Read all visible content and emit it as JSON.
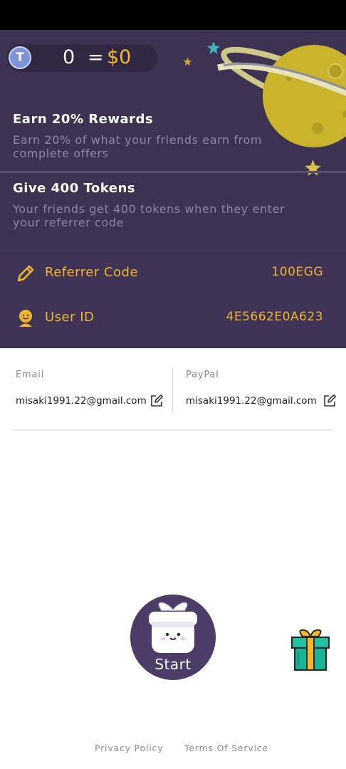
{
  "balance": {
    "tokens": "0",
    "equals": "=",
    "usd": "$0",
    "coin_letter": "T"
  },
  "rewards": [
    {
      "title": "Earn 20% Rewards",
      "desc": "Earn 20% of what your friends earn from complete offers"
    },
    {
      "title": "Give 400 Tokens",
      "desc": "Your friends get 400 tokens when they enter your referrer code"
    }
  ],
  "info": {
    "referrer": {
      "label": "Referrer Code",
      "value": "100EGG"
    },
    "user": {
      "label": "User ID",
      "value": "4E5662E0A623"
    }
  },
  "payment": {
    "email": {
      "label": "Email",
      "value": "misaki1991.22@gmail.com"
    },
    "paypal": {
      "label": "PayPal",
      "value": "misaki1991.22@gmail.com"
    }
  },
  "start": {
    "label": "Start"
  },
  "footer": {
    "privacy": "Privacy Policy",
    "terms": "Terms Of Service"
  },
  "colors": {
    "hero_bg": "#3d3252",
    "accent": "#f0b52c",
    "start_bg": "#4b3c68",
    "gift": "#1fb89a"
  },
  "icons": [
    "token-coin-icon",
    "planet-icon",
    "star-icon",
    "pencil-icon",
    "user-smile-icon",
    "edit-icon",
    "gift-box-icon"
  ]
}
